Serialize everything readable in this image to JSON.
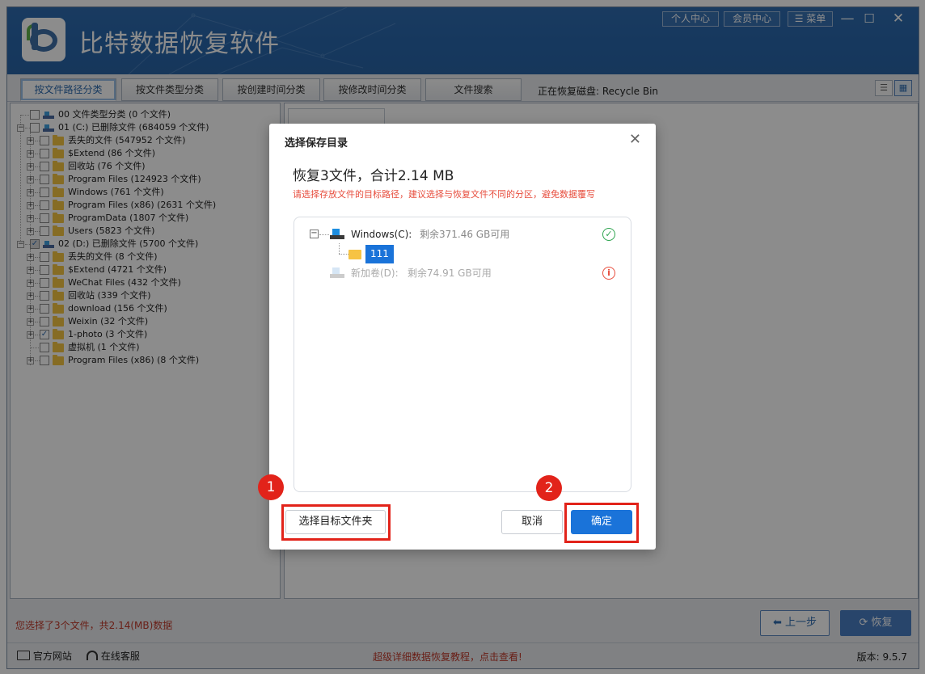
{
  "app": {
    "title": "比特数据恢复软件",
    "personal_center": "个人中心",
    "member_center": "会员中心",
    "menu": "菜单",
    "menu_icon": "list-icon",
    "min": "—",
    "max": "☐",
    "close": "✕"
  },
  "tabs": [
    {
      "label": "按文件路径分类",
      "active": true
    },
    {
      "label": "按文件类型分类"
    },
    {
      "label": "按创建时间分类"
    },
    {
      "label": "按修改时间分类"
    },
    {
      "label": "文件搜索"
    }
  ],
  "recovering_disk": "正在恢复磁盘: Recycle Bin",
  "tree": [
    {
      "label": "00 文件类型分类   (0 个文件)",
      "icon": "drive",
      "level": 0
    },
    {
      "label": "01 (C:) 已删除文件  (684059 个文件)",
      "icon": "drive",
      "level": 0,
      "expanded": true
    },
    {
      "label": "丢失的文件    (547952 个文件)",
      "icon": "folder",
      "level": 1
    },
    {
      "label": "$Extend    (86 个文件)",
      "icon": "folder",
      "level": 1
    },
    {
      "label": "回收站    (76 个文件)",
      "icon": "folder",
      "level": 1
    },
    {
      "label": "Program Files    (124923 个文件)",
      "icon": "folder",
      "level": 1
    },
    {
      "label": "Windows    (761 个文件)",
      "icon": "folder",
      "level": 1
    },
    {
      "label": "Program Files (x86)    (2631 个文件)",
      "icon": "folder",
      "level": 1
    },
    {
      "label": "ProgramData    (1807 个文件)",
      "icon": "folder",
      "level": 1
    },
    {
      "label": "Users    (5823 个文件)",
      "icon": "folder",
      "level": 1
    },
    {
      "label": "02 (D:) 已删除文件  (5700 个文件)",
      "icon": "drive",
      "level": 0,
      "expanded": true,
      "partial": true
    },
    {
      "label": "丢失的文件    (8 个文件)",
      "icon": "folder",
      "level": 1
    },
    {
      "label": "$Extend    (4721 个文件)",
      "icon": "folder",
      "level": 1
    },
    {
      "label": "WeChat Files    (432 个文件)",
      "icon": "folder",
      "level": 1
    },
    {
      "label": "回收站    (339 个文件)",
      "icon": "folder",
      "level": 1
    },
    {
      "label": "download    (156 个文件)",
      "icon": "folder",
      "level": 1
    },
    {
      "label": "Weixin    (32 个文件)",
      "icon": "folder",
      "level": 1
    },
    {
      "label": "1-photo    (3 个文件)",
      "icon": "folder",
      "level": 1,
      "checked": true
    },
    {
      "label": "虚拟机    (1 个文件)",
      "icon": "folder",
      "level": 1,
      "noexp": true
    },
    {
      "label": "Program Files (x86)    (8 个文件)",
      "icon": "folder",
      "level": 1
    }
  ],
  "status_msg": "您选择了3个文件，共2.14(MB)数据",
  "btn_prev": "上一步",
  "btn_recover": "恢复",
  "footer": {
    "website": "官方网站",
    "support": "在线客服",
    "tutorial": "超级详细数据恢复教程，点击查看!",
    "version": "版本: 9.5.7"
  },
  "dialog": {
    "title": "选择保存目录",
    "close": "✕",
    "heading": "恢复3文件，合计2.14 MB",
    "hint": "请选择存放文件的目标路径，建议选择与恢复文件不同的分区，避免数据覆写",
    "drive_c": "Windows(C):",
    "drive_c_free": "剩余371.46 GB可用",
    "folder": "111",
    "drive_d": "新加卷(D):",
    "drive_d_free": "剩余74.91 GB可用",
    "choose_btn": "选择目标文件夹",
    "cancel_btn": "取消",
    "ok_btn": "确定",
    "ok_mark": "✓",
    "warn_mark": "i",
    "badge1": "1",
    "badge2": "2"
  },
  "colors": {
    "accent": "#1a73d9",
    "title_bar": "#2f6cb0",
    "highlight": "#e2231a",
    "warning_text": "#e74c3c"
  }
}
